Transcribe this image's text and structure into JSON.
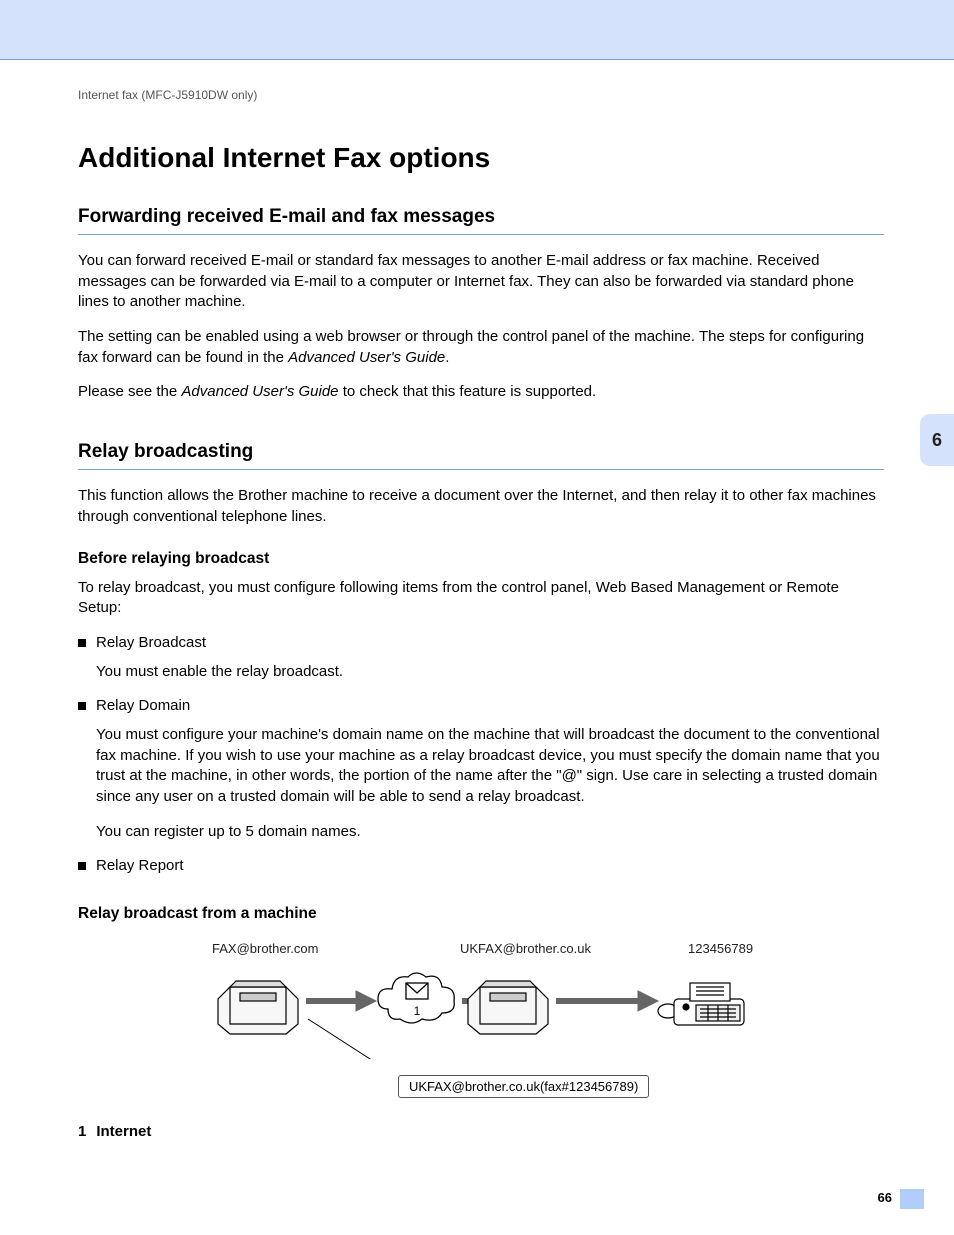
{
  "crumb": "Internet fax (MFC-J5910DW only)",
  "h1": "Additional Internet Fax options",
  "sec1": {
    "title": "Forwarding received E-mail and fax messages",
    "p1": "You can forward received E-mail or standard fax messages to another E-mail address or fax machine. Received messages can be forwarded via E-mail to a computer or Internet fax. They can also be forwarded via standard phone lines to another machine.",
    "p2a": "The setting can be enabled using a web browser or through the control panel of the machine. The steps for configuring fax forward can be found in the ",
    "p2b": "Advanced User's Guide",
    "p2c": ".",
    "p3a": "Please see the ",
    "p3b": "Advanced User's Guide",
    "p3c": " to check that this feature is supported."
  },
  "sec2": {
    "title": "Relay broadcasting",
    "p1": "This function allows the Brother machine to receive a document over the Internet, and then relay it to other fax machines through conventional telephone lines.",
    "sub1": {
      "title": "Before relaying broadcast",
      "intro": "To relay broadcast, you must configure following items from the control panel, Web Based Management or Remote Setup:",
      "b1": "Relay Broadcast",
      "b1sub": "You must enable the relay broadcast.",
      "b2": "Relay Domain",
      "b2sub1": "You must configure your machine's domain name on the machine that will broadcast the document to the conventional fax machine. If you wish to use your machine as a relay broadcast device, you must specify the domain name that you trust at the machine, in other words, the portion of the name after the \"@\" sign. Use care in selecting a trusted domain since any user on a trusted domain will be able to send a relay broadcast.",
      "b2sub2": "You can register up to 5 domain names.",
      "b3": "Relay Report"
    },
    "sub2": {
      "title": "Relay broadcast from a machine",
      "label1": "FAX@brother.com",
      "label2": "UKFAX@brother.co.uk",
      "label3": "123456789",
      "cloudnum": "1",
      "bottombox": "UKFAX@brother.co.uk(fax#123456789)",
      "legend_num": "1",
      "legend_txt": "Internet"
    }
  },
  "chapter": "6",
  "pagenum": "66"
}
